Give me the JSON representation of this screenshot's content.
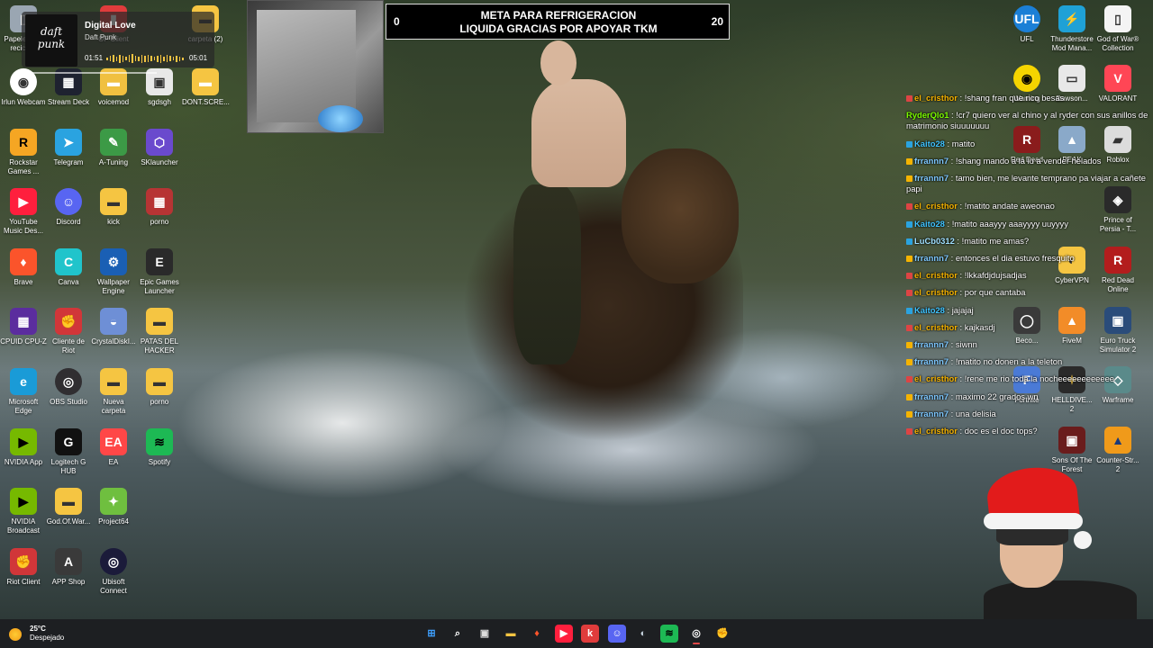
{
  "goal_banner": {
    "current": "0",
    "target": "20",
    "title_line1": "META PARA REFRIGERACION",
    "title_line2": "LIQUIDA GRACIAS POR APOYAR TKM"
  },
  "media_widget": {
    "title": "Digital Love",
    "artist": "Daft Punk",
    "elapsed": "01:51",
    "duration": "05:01",
    "album_art_text": "daft punk"
  },
  "desktop_icons": [
    {
      "label": "Irlun Webcam",
      "glyph": "◉",
      "color": "#ffffff",
      "fg": "#333"
    },
    {
      "label": "Stream Deck",
      "glyph": "▦",
      "color": "#1e2230",
      "fg": "#fff"
    },
    {
      "label": "voicemod",
      "glyph": "▬",
      "color": "#f0c040",
      "fg": "#fff"
    },
    {
      "label": "sgdsgh",
      "glyph": "▣",
      "color": "#e8e8e8",
      "fg": "#333"
    },
    {
      "label": "DONT.SCRE...",
      "glyph": "▬",
      "color": "#f5c542",
      "fg": "#fff"
    },
    {
      "label": "Rockstar Games ...",
      "glyph": "R",
      "color": "#f5a623",
      "fg": "#000"
    },
    {
      "label": "Telegram",
      "glyph": "➤",
      "color": "#2aa3e0",
      "fg": "#fff"
    },
    {
      "label": "A-Tuning",
      "glyph": "✎",
      "color": "#3c9a46",
      "fg": "#fff"
    },
    {
      "label": "SKlauncher",
      "glyph": "⬡",
      "color": "#6a4acd",
      "fg": "#fff"
    },
    {
      "label": "YouTube Music Des...",
      "glyph": "▶",
      "color": "#ff1f3d",
      "fg": "#fff"
    },
    {
      "label": "Discord",
      "glyph": "☺",
      "color": "#5865f2",
      "fg": "#fff"
    },
    {
      "label": "kick",
      "glyph": "▬",
      "color": "#f5c542",
      "fg": "#333"
    },
    {
      "label": "porno",
      "glyph": "▦",
      "color": "#b73434",
      "fg": "#fff"
    },
    {
      "label": "Brave",
      "glyph": "♦",
      "color": "#fb542b",
      "fg": "#fff"
    },
    {
      "label": "Canva",
      "glyph": "C",
      "color": "#20c4cb",
      "fg": "#fff"
    },
    {
      "label": "Wallpaper Engine",
      "glyph": "⚙",
      "color": "#1a5fb4",
      "fg": "#fff"
    },
    {
      "label": "Epic Games Launcher",
      "glyph": "E",
      "color": "#2a2a2a",
      "fg": "#fff"
    },
    {
      "label": "CPUID CPU-Z",
      "glyph": "▦",
      "color": "#5b2d9e",
      "fg": "#fff"
    },
    {
      "label": "Cliente de Riot",
      "glyph": "✊",
      "color": "#d13639",
      "fg": "#fff"
    },
    {
      "label": "CrystalDiskI...",
      "glyph": "◒",
      "color": "#6e8fd6",
      "fg": "#fff"
    },
    {
      "label": "PATAS DEL HACKER",
      "glyph": "▬",
      "color": "#f5c542",
      "fg": "#333"
    },
    {
      "label": "Microsoft Edge",
      "glyph": "e",
      "color": "#1a9bd7",
      "fg": "#fff"
    },
    {
      "label": "OBS Studio",
      "glyph": "◎",
      "color": "#302e31",
      "fg": "#fff"
    },
    {
      "label": "Nueva carpeta",
      "glyph": "▬",
      "color": "#f5c542",
      "fg": "#333"
    },
    {
      "label": "porno",
      "glyph": "▬",
      "color": "#f5c542",
      "fg": "#333"
    },
    {
      "label": "NVIDIA App",
      "glyph": "▶",
      "color": "#76b900",
      "fg": "#000"
    },
    {
      "label": "Logitech G HUB",
      "glyph": "G",
      "color": "#111111",
      "fg": "#fff"
    },
    {
      "label": "EA",
      "glyph": "EA",
      "color": "#ff4747",
      "fg": "#fff"
    },
    {
      "label": "Spotify",
      "glyph": "≋",
      "color": "#1db954",
      "fg": "#000"
    },
    {
      "label": "NVIDIA Broadcast",
      "glyph": "▶",
      "color": "#76b900",
      "fg": "#000"
    },
    {
      "label": "God.Of.War...",
      "glyph": "▬",
      "color": "#f5c542",
      "fg": "#333"
    },
    {
      "label": "Project64",
      "glyph": "✦",
      "color": "#6fbf3f",
      "fg": "#fff"
    },
    {
      "label": "Riot Client",
      "glyph": "✊",
      "color": "#d13639",
      "fg": "#fff"
    },
    {
      "label": "APP Shop",
      "glyph": "A",
      "color": "#3a3a3a",
      "fg": "#fff"
    },
    {
      "label": "Ubisoft Connect",
      "glyph": "◎",
      "color": "#1b1b3a",
      "fg": "#fff"
    },
    {
      "label": "UFL",
      "glyph": "UFL",
      "color": "#1b7fd6",
      "fg": "#fff"
    },
    {
      "label": "Thunderstore Mod Mana...",
      "glyph": "⚡",
      "color": "#1fa1d6",
      "fg": "#fff"
    },
    {
      "label": "God of War® Collection",
      "glyph": "▯",
      "color": "#f4f4f4",
      "fg": "#333"
    },
    {
      "label": "Warning",
      "glyph": "◉",
      "color": "#f5d400",
      "fg": "#000"
    },
    {
      "label": "Dawson...",
      "glyph": "▭",
      "color": "#e8e8e8",
      "fg": "#333"
    },
    {
      "label": "VALORANT",
      "glyph": "V",
      "color": "#ff4655",
      "fg": "#fff"
    },
    {
      "label": "Red Dead",
      "glyph": "R",
      "color": "#8a1c1c",
      "fg": "#fff"
    },
    {
      "label": "PEAK",
      "glyph": "▲",
      "color": "#8aa9c9",
      "fg": "#fff"
    },
    {
      "label": "Roblox",
      "glyph": "▰",
      "color": "#dcdcdc",
      "fg": "#333"
    },
    {
      "label": "Prince of Persia - T...",
      "glyph": "◈",
      "color": "#2a2a2a",
      "fg": "#fff"
    },
    {
      "label": "CyberVPN",
      "glyph": "◐",
      "color": "#f5c542",
      "fg": "#333"
    },
    {
      "label": "Red Dead Online",
      "glyph": "R",
      "color": "#b31d1d",
      "fg": "#fff"
    },
    {
      "label": "Beco...",
      "glyph": "◯",
      "color": "#3a3a3a",
      "fg": "#fff"
    },
    {
      "label": "FiveM",
      "glyph": "▲",
      "color": "#f28c28",
      "fg": "#fff"
    },
    {
      "label": "Euro Truck Simulator 2",
      "glyph": "▣",
      "color": "#2a4c7a",
      "fg": "#fff"
    },
    {
      "label": "Fortnite",
      "glyph": "F",
      "color": "#4a7ad6",
      "fg": "#fff"
    },
    {
      "label": "HELLDIVE... 2",
      "glyph": "✦",
      "color": "#2a2a2a",
      "fg": "#f5c542"
    },
    {
      "label": "Warframe",
      "glyph": "◇",
      "color": "#5a8a8a",
      "fg": "#fff"
    },
    {
      "label": "Sons Of The Forest",
      "glyph": "▣",
      "color": "#6a1c1c",
      "fg": "#fff"
    },
    {
      "label": "Counter-Str... 2",
      "glyph": "▲",
      "color": "#f09a1a",
      "fg": "#1a3a7a"
    },
    {
      "label": "Papelera de reciclaje",
      "glyph": "▯",
      "color": "#9aa6b2",
      "fg": "#fff"
    },
    {
      "label": "OF Client",
      "glyph": "▮",
      "color": "#e03c3c",
      "fg": "#fff"
    },
    {
      "label": "carpeta (2)",
      "glyph": "▬",
      "color": "#f5c542",
      "fg": "#333"
    }
  ],
  "chat": [
    {
      "user": "el_cristhor",
      "color": "#f5b300",
      "badge": "#d44",
      "text": ": !shang fran que rico besas"
    },
    {
      "user": "RyderQlo1",
      "color": "#7cfc00",
      "badge": "",
      "text": ": !cr7 quiero ver al chino y al ryder con sus anillos de matrimonio siuuuuuuu"
    },
    {
      "user": "Kaito28",
      "color": "#40c4ff",
      "badge": "#2aa3e0",
      "text": ": matito"
    },
    {
      "user": "frrannn7",
      "color": "#7ec8ff",
      "badge": "#f5b300",
      "text": ": !shang mando a la lu a vender helados"
    },
    {
      "user": "frrannn7",
      "color": "#7ec8ff",
      "badge": "#f5b300",
      "text": ": tamo bien, me levante temprano pa viajar a cañete papi"
    },
    {
      "user": "el_cristhor",
      "color": "#f5b300",
      "badge": "#d44",
      "text": ": !matito andate aweonao"
    },
    {
      "user": "Kaito28",
      "color": "#40c4ff",
      "badge": "#2aa3e0",
      "text": ": !matito aaayyy aaayyyy uuyyyy"
    },
    {
      "user": "LuCb0312",
      "color": "#a0e0ff",
      "badge": "#2aa3e0",
      "text": ": !matito me amas?"
    },
    {
      "user": "frrannn7",
      "color": "#7ec8ff",
      "badge": "#f5b300",
      "text": ": entonces el dia estuvo fresquito"
    },
    {
      "user": "el_cristhor",
      "color": "#f5b300",
      "badge": "#d44",
      "text": ": !lkkafdjdujsadjas"
    },
    {
      "user": "el_cristhor",
      "color": "#f5b300",
      "badge": "#d44",
      "text": ": por que cantaba"
    },
    {
      "user": "Kaito28",
      "color": "#40c4ff",
      "badge": "#2aa3e0",
      "text": ": jajajaj"
    },
    {
      "user": "el_cristhor",
      "color": "#f5b300",
      "badge": "#d44",
      "text": ": kajkasdj"
    },
    {
      "user": "frrannn7",
      "color": "#7ec8ff",
      "badge": "#f5b300",
      "text": ": siwnn"
    },
    {
      "user": "frrannn7",
      "color": "#7ec8ff",
      "badge": "#f5b300",
      "text": ": !matito no donen a la teleton"
    },
    {
      "user": "el_cristhor",
      "color": "#f5b300",
      "badge": "#d44",
      "text": ": !rene me rio toda la nocheeeeeeeeeeee"
    },
    {
      "user": "frrannn7",
      "color": "#7ec8ff",
      "badge": "#f5b300",
      "text": ": maximo 22 grados wn"
    },
    {
      "user": "frrannn7",
      "color": "#7ec8ff",
      "badge": "#f5b300",
      "text": ": una delisia"
    },
    {
      "user": "el_cristhor",
      "color": "#f5b300",
      "badge": "#d44",
      "text": ": doc es el doc tops?"
    }
  ],
  "taskbar": {
    "weather_temp": "25°C",
    "weather_condition": "Despejado",
    "apps": [
      {
        "name": "start-icon",
        "glyph": "⊞",
        "bg": "transparent",
        "fg": "#3ea0ff"
      },
      {
        "name": "search-icon",
        "glyph": "⌕",
        "bg": "transparent",
        "fg": "#ffffff"
      },
      {
        "name": "task-view-icon",
        "glyph": "▣",
        "bg": "transparent",
        "fg": "#dddddd"
      },
      {
        "name": "file-explorer-icon",
        "glyph": "▬",
        "bg": "transparent",
        "fg": "#f5c542"
      },
      {
        "name": "brave-icon",
        "glyph": "♦",
        "bg": "transparent",
        "fg": "#fb542b"
      },
      {
        "name": "youtube-music-icon",
        "glyph": "▶",
        "bg": "#ff1f3d",
        "fg": "#ffffff"
      },
      {
        "name": "app-red-icon",
        "glyph": "k",
        "bg": "#e03c3c",
        "fg": "#ffffff"
      },
      {
        "name": "discord-icon",
        "glyph": "☺",
        "bg": "#5865f2",
        "fg": "#ffffff"
      },
      {
        "name": "steam-icon",
        "glyph": "◐",
        "bg": "transparent",
        "fg": "#c7d5e0"
      },
      {
        "name": "spotify-icon",
        "glyph": "≋",
        "bg": "#1db954",
        "fg": "#000000"
      },
      {
        "name": "obs-icon",
        "glyph": "◎",
        "bg": "transparent",
        "fg": "#ffffff"
      },
      {
        "name": "riot-icon",
        "glyph": "✊",
        "bg": "transparent",
        "fg": "#e03c3c"
      }
    ]
  }
}
